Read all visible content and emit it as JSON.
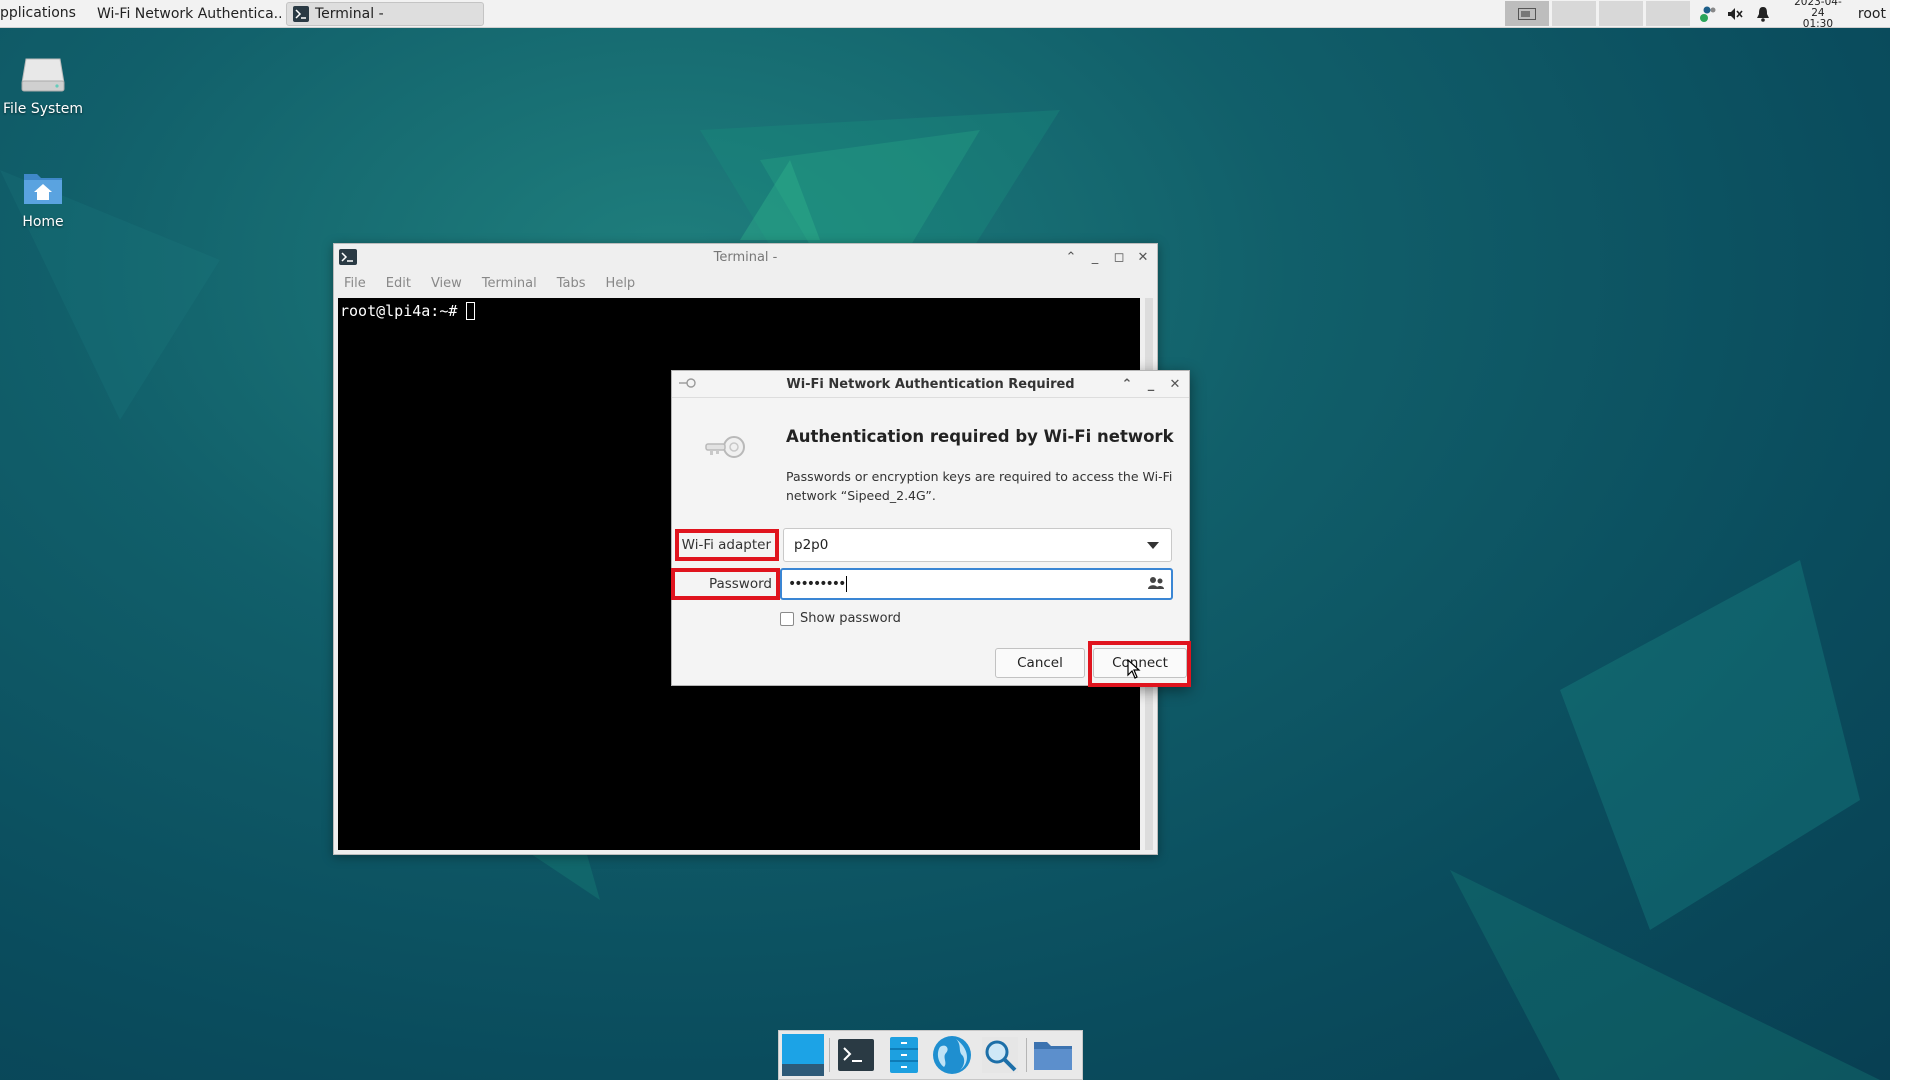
{
  "top_panel": {
    "apps_menu": "pplications",
    "tasks": [
      {
        "label": "Wi-Fi Network Authentica..."
      },
      {
        "label": "Terminal -"
      }
    ],
    "clock": {
      "date": "2023-04-24",
      "time": "01:30"
    },
    "user": "root"
  },
  "desktop": {
    "icons": [
      {
        "label": "File System"
      },
      {
        "label": "Home"
      }
    ]
  },
  "terminal": {
    "title": "Terminal -",
    "menu": [
      "File",
      "Edit",
      "View",
      "Terminal",
      "Tabs",
      "Help"
    ],
    "prompt": "root@lpi4a:~# "
  },
  "dialog": {
    "title": "Wi-Fi Network Authentication Required",
    "heading": "Authentication required by Wi-Fi network",
    "message": "Passwords or encryption keys are required to access the Wi-Fi network “Sipeed_2.4G”.",
    "adapter_label": "Wi-Fi adapter",
    "adapter_value": "p2p0",
    "password_label": "Password",
    "password_value": "•••••••••",
    "show_password_label": "Show password",
    "show_password_checked": false,
    "cancel_label": "Cancel",
    "connect_label": "Connect"
  },
  "colors": {
    "highlight": "#e0141e",
    "focus": "#3a86d4",
    "wallpaper": "#0d5d68"
  },
  "dock": {
    "items": [
      "show-desktop-icon",
      "terminal-icon",
      "file-manager-icon",
      "web-browser-icon",
      "app-finder-icon",
      "folder-icon"
    ]
  }
}
